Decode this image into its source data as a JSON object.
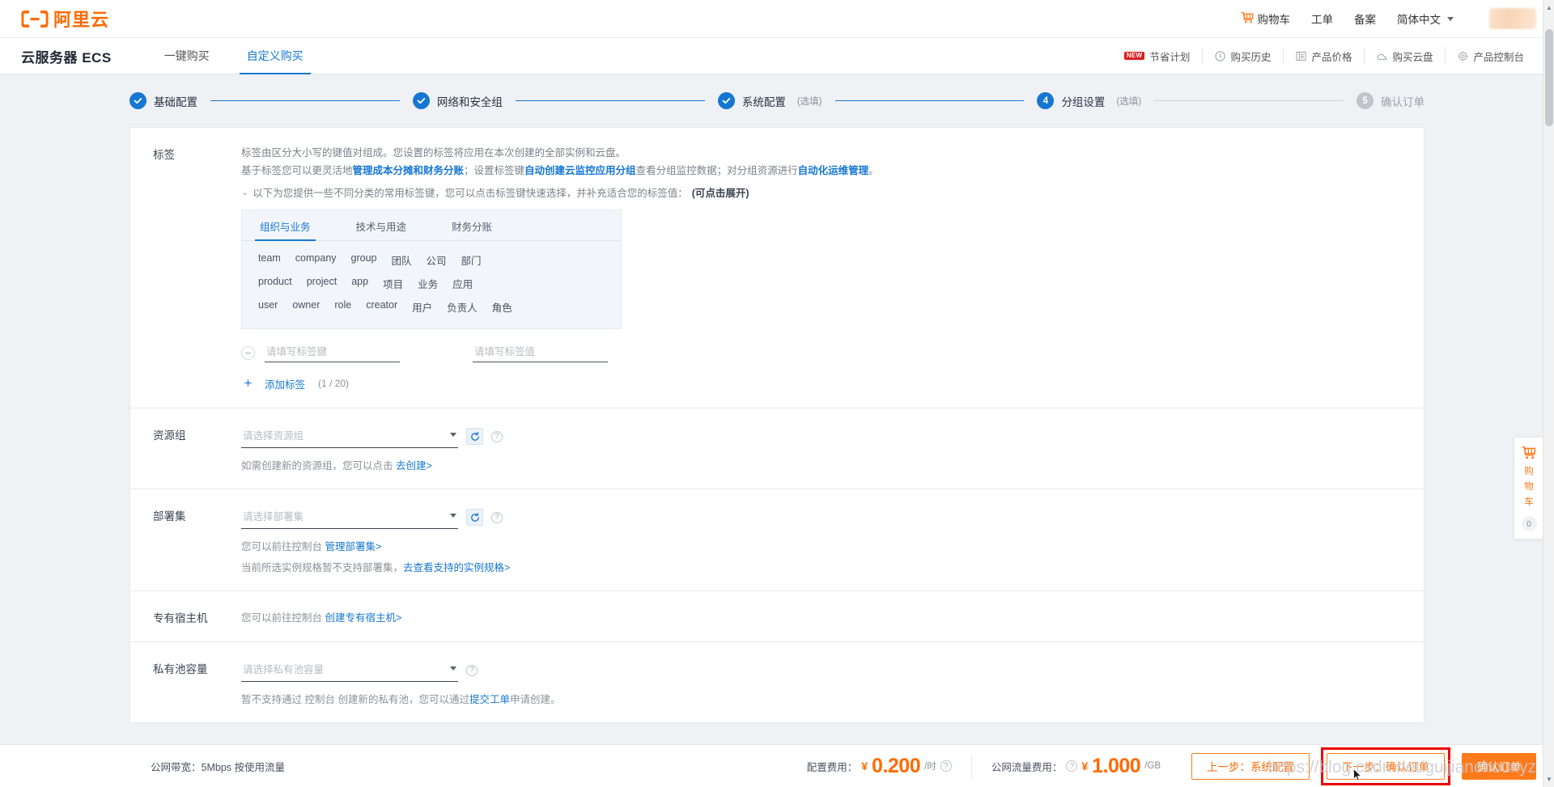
{
  "header": {
    "logo_text": "阿里云",
    "logo_icon": "aliyun-logo-icon",
    "nav": [
      {
        "label": "购物车",
        "icon": "cart-icon"
      },
      {
        "label": "工单",
        "icon": ""
      },
      {
        "label": "备案",
        "icon": ""
      },
      {
        "label": "简体中文",
        "icon": "chevron-down-icon"
      }
    ]
  },
  "subheader": {
    "product_title": "云服务器 ECS",
    "tabs": [
      {
        "label": "一键购买",
        "active": false
      },
      {
        "label": "自定义购买",
        "active": true
      }
    ],
    "links": [
      {
        "label": "节省计划",
        "badge": "NEW",
        "icon": ""
      },
      {
        "label": "购买历史",
        "badge": "",
        "icon": "clock-icon"
      },
      {
        "label": "产品价格",
        "badge": "",
        "icon": "list-icon"
      },
      {
        "label": "购买云盘",
        "badge": "",
        "icon": "disk-icon"
      },
      {
        "label": "产品控制台",
        "badge": "",
        "icon": "gear-icon"
      }
    ]
  },
  "stepper": [
    {
      "num": "1",
      "label": "基础配置",
      "optional": "",
      "state": "done"
    },
    {
      "num": "2",
      "label": "网络和安全组",
      "optional": "",
      "state": "done"
    },
    {
      "num": "3",
      "label": "系统配置",
      "optional": "(选填)",
      "state": "done"
    },
    {
      "num": "4",
      "label": "分组设置",
      "optional": "(选填)",
      "state": "current"
    },
    {
      "num": "5",
      "label": "确认订单",
      "optional": "",
      "state": "todo"
    }
  ],
  "tags": {
    "label": "标签",
    "desc_line1": "标签由区分大小写的键值对组成。您设置的标签将应用在本次创建的全部实例和云盘。",
    "desc_line2_pre": "基于标签您可以更灵活地",
    "desc_line2_link1": "管理成本分摊和财务分账",
    "desc_line2_mid1": "；设置标签键",
    "desc_line2_link2": "自动创建云监控应用分组",
    "desc_line2_mid2": "查看分组监控数据；对分组资源进行",
    "desc_line2_link3": "自动化运维管理",
    "desc_line2_end": "。",
    "expand_chevron": "⌄",
    "expand_text": "以下为您提供一些不同分类的常用标签键，您可以点击标签键快速选择，并补充适合您的标签值：",
    "expand_strong": "(可点击展开)",
    "panel_tabs": [
      {
        "label": "组织与业务",
        "active": true
      },
      {
        "label": "技术与用途",
        "active": false
      },
      {
        "label": "财务分账",
        "active": false
      }
    ],
    "chip_rows": [
      [
        "team",
        "company",
        "group",
        "团队",
        "公司",
        "部门"
      ],
      [
        "product",
        "project",
        "app",
        "项目",
        "业务",
        "应用"
      ],
      [
        "user",
        "owner",
        "role",
        "creator",
        "用户",
        "负责人",
        "角色"
      ]
    ],
    "minus_glyph": "−",
    "key_placeholder": "请填写标签键",
    "key_value": "",
    "value_placeholder": "请填写标签值",
    "value_value": "",
    "plus_glyph": "+",
    "add_tag_label": "添加标签",
    "add_tag_count": "(1 / 20)"
  },
  "resource_group": {
    "label": "资源组",
    "placeholder": "请选择资源组",
    "value": "",
    "refresh_icon": "refresh-icon",
    "help_icon": "help-icon",
    "hint_pre": "如需创建新的资源组，您可以点击 ",
    "hint_link": "去创建>"
  },
  "deployment_set": {
    "label": "部署集",
    "placeholder": "请选择部署集",
    "value": "",
    "refresh_icon": "refresh-icon",
    "help_icon": "help-icon",
    "hint1_pre": "您可以前往控制台 ",
    "hint1_link": "管理部署集>",
    "hint2_pre": "当前所选实例规格暂不支持部署集，",
    "hint2_link": "去查看支持的实例规格>"
  },
  "dedicated_host": {
    "label": "专有宿主机",
    "hint_pre": "您可以前往控制台 ",
    "hint_link": "创建专有宿主机>"
  },
  "private_pool": {
    "label": "私有池容量",
    "placeholder": "请选择私有池容量",
    "value": "",
    "help_icon": "help-icon",
    "hint_pre": "暂不支持通过 控制台 创建新的私有池，您可以通过",
    "hint_link": "提交工单",
    "hint_post": "申请创建。"
  },
  "footer": {
    "summary": "公网带宽：5Mbps 按使用流量",
    "price1": {
      "label": "配置费用：",
      "currency": "¥",
      "amount": "0.200",
      "unit": "/时",
      "help_icon": "help-icon"
    },
    "price2": {
      "label": "公网流量费用：",
      "currency": "¥",
      "amount": "1.000",
      "unit": "/GB",
      "help_icon": "help-icon"
    },
    "buttons": [
      {
        "label": "上一步：系统配置",
        "style": "ghost",
        "highlight": false
      },
      {
        "label": "下一步：确认订单",
        "style": "ghost",
        "highlight": true
      },
      {
        "label": "确认订单",
        "style": "primary",
        "highlight": false
      }
    ]
  },
  "float_cart": {
    "icon": "cart-icon",
    "chars": [
      "购",
      "物",
      "车"
    ],
    "count": "0"
  },
  "watermark": "https://blog.csdn.net/guijianchouxyz",
  "colors": {
    "brand_orange": "#ff6a00",
    "link_blue": "#1677d2",
    "highlight_red": "#f00000",
    "page_bg": "#eff1f5"
  }
}
